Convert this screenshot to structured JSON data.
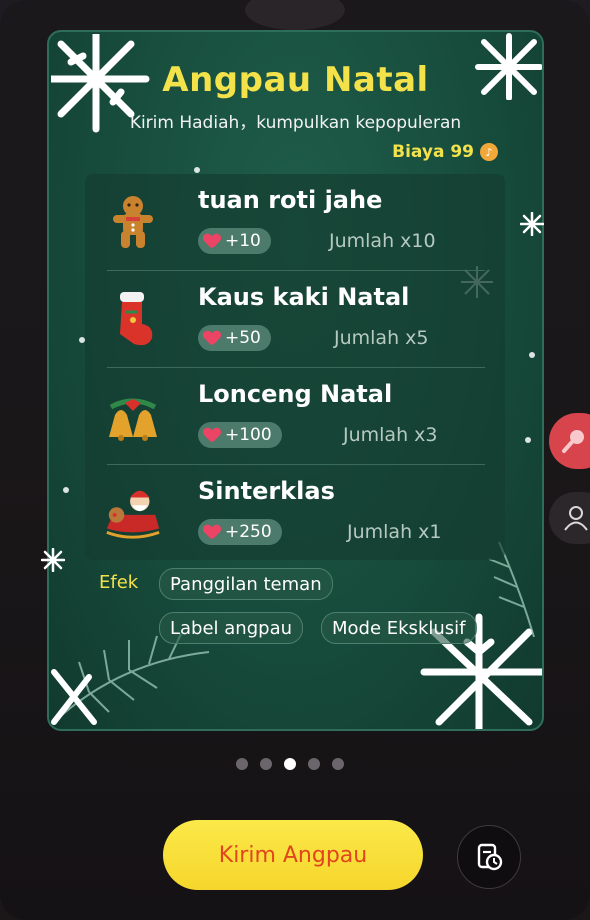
{
  "card": {
    "title": "Angpau Natal",
    "subtitle": "Kirim Hadiah，kumpulkan kepopuleran",
    "cost_label": "Biaya 99"
  },
  "items": [
    {
      "name": "tuan roti jahe",
      "points": "+10",
      "qty": "Jumlah x10",
      "icon": "gingerbread-man-icon"
    },
    {
      "name": "Kaus kaki Natal",
      "points": "+50",
      "qty": "Jumlah x5",
      "icon": "christmas-stocking-icon"
    },
    {
      "name": "Lonceng Natal",
      "points": "+100",
      "qty": "Jumlah x3",
      "icon": "christmas-bell-icon"
    },
    {
      "name": "Sinterklas",
      "points": "+250",
      "qty": "Jumlah x1",
      "icon": "santa-sleigh-icon"
    }
  ],
  "effects": {
    "label": "Efek",
    "chips": [
      "Panggilan teman",
      "Label angpau",
      "Mode Eksklusif"
    ]
  },
  "pager": {
    "count": 5,
    "active_index": 2
  },
  "send_button": "Kirim Angpau",
  "colors": {
    "accent_yellow": "#f3e24a",
    "card_green": "#174c3c",
    "button_text": "#e2451d",
    "heart": "#ec4464"
  }
}
